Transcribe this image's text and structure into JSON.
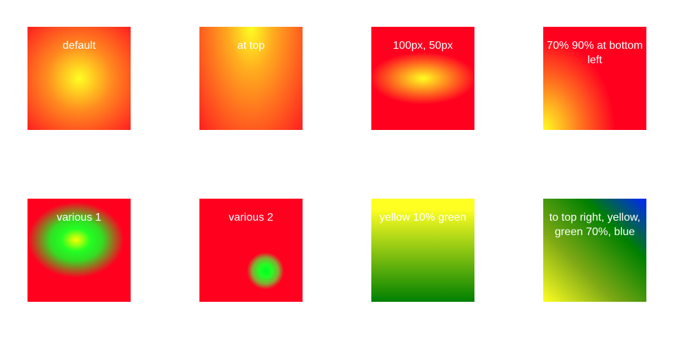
{
  "tiles": [
    {
      "label": "default"
    },
    {
      "label": "at top"
    },
    {
      "label": "100px, 50px"
    },
    {
      "label": "70% 90% at bottom left"
    },
    {
      "label": "various 1"
    },
    {
      "label": "various 2"
    },
    {
      "label": "yellow 10% green"
    },
    {
      "label": "to top right, yellow, green 70%, blue"
    }
  ],
  "colors": {
    "red": "#ff001f",
    "yellow": "#ffff22",
    "green": "#008000",
    "lime": "#22ff22",
    "blue": "#0024ff"
  }
}
